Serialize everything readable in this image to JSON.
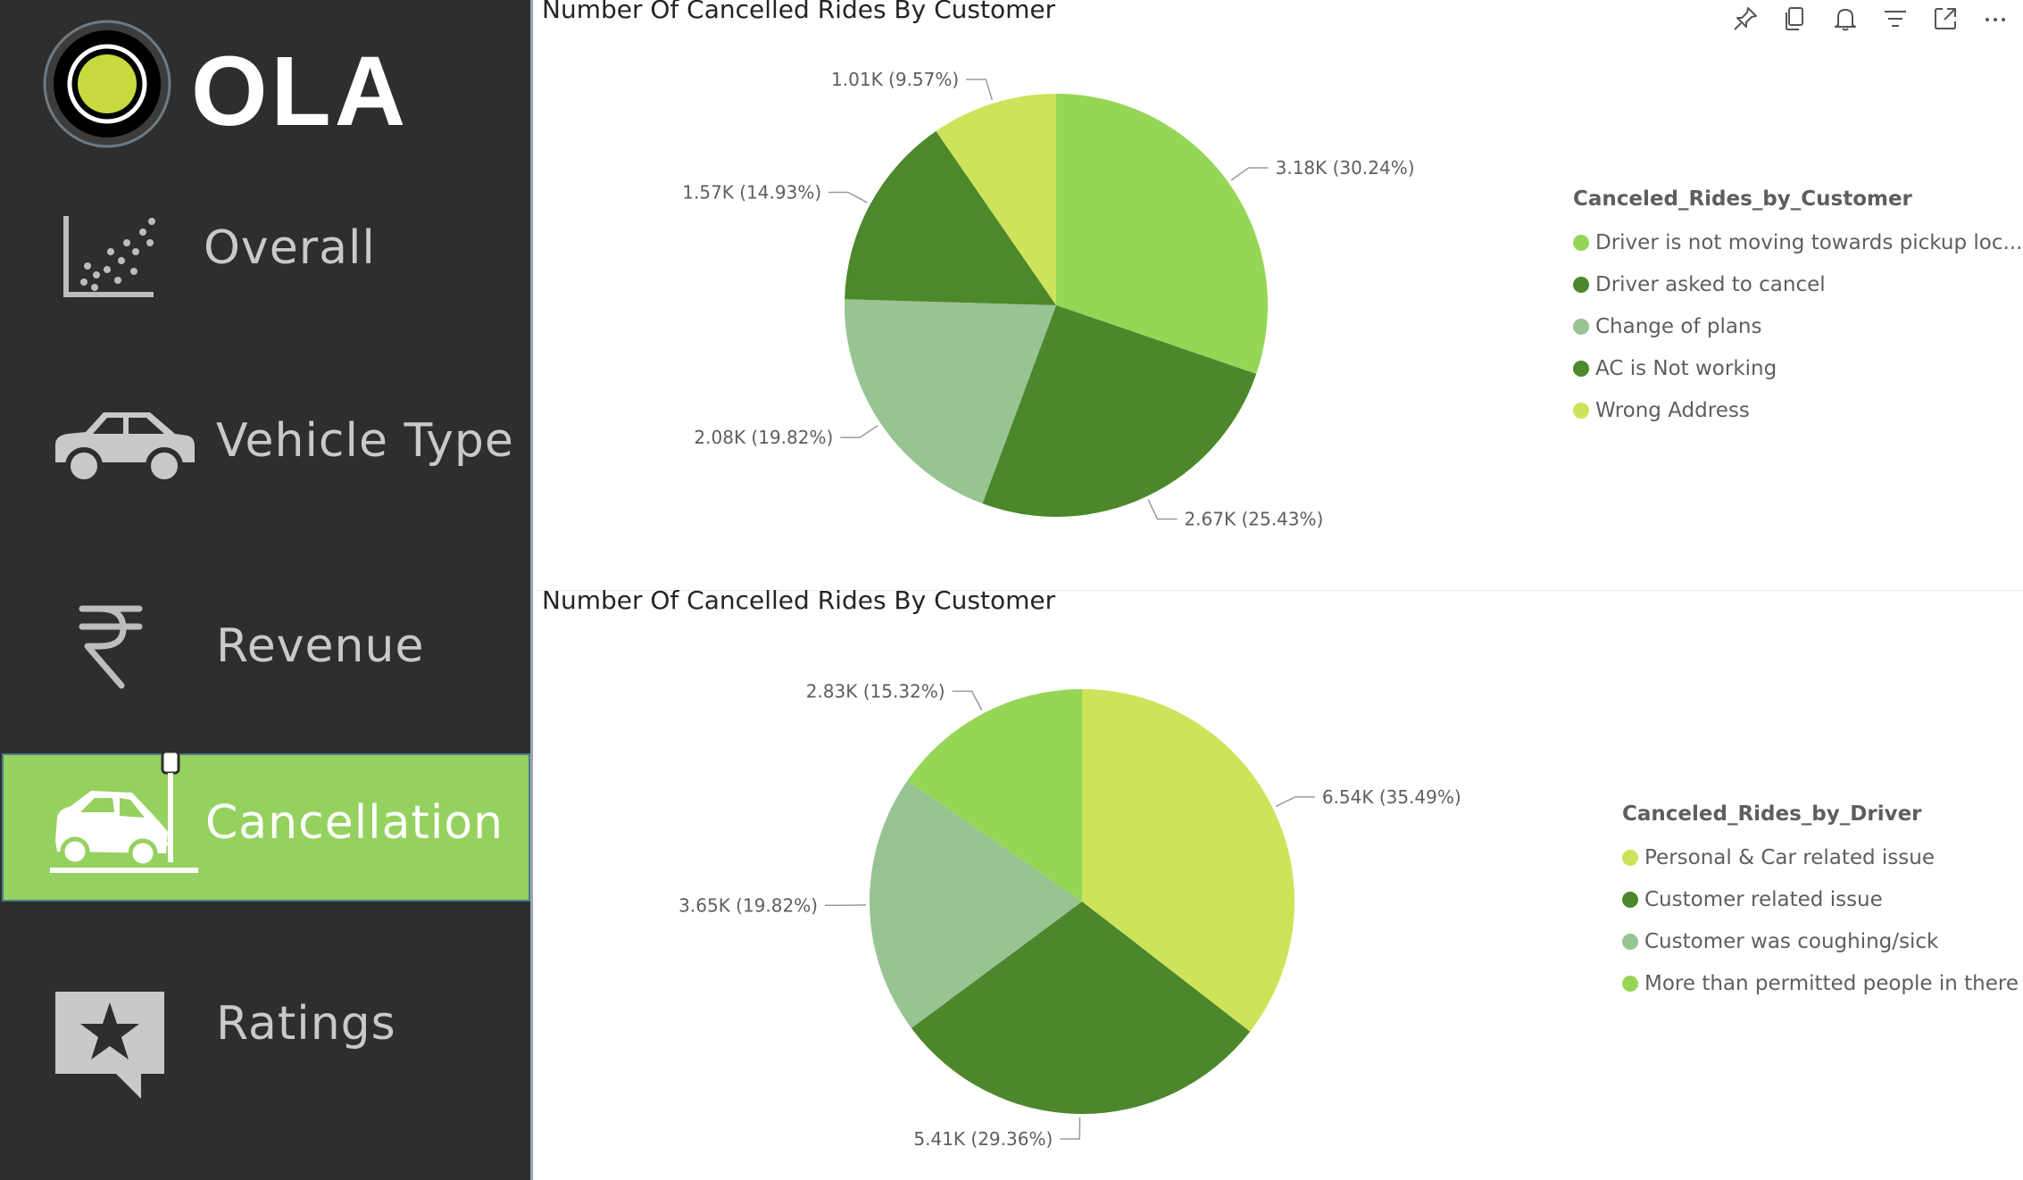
{
  "sidebar": {
    "logo_text": "OLA",
    "items": [
      {
        "label": "Overall",
        "icon": "scatter-plot-icon",
        "active": false
      },
      {
        "label": "Vehicle Type",
        "icon": "car-icon",
        "active": false
      },
      {
        "label": "Revenue",
        "icon": "rupee-icon",
        "active": false
      },
      {
        "label": "Cancellation",
        "icon": "car-crash-icon",
        "active": true
      },
      {
        "label": "Ratings",
        "icon": "star-comment-icon",
        "active": false
      }
    ],
    "active_color": "#95d15e",
    "background": "#2e2e2e"
  },
  "toolbar": {
    "icons": [
      "pin-icon",
      "copy-icon",
      "bell-icon",
      "filter-icon",
      "focus-mode-icon",
      "more-options-icon"
    ]
  },
  "chart_data": [
    {
      "type": "pie",
      "title": "Number Of Cancelled Rides By Customer",
      "legend_title": "Canceled_Rides_by_Customer",
      "legend_position": "right",
      "categories": [
        "Driver is not moving towards pickup loc...",
        "Driver asked to cancel",
        "Change of plans",
        "AC is Not working",
        "Wrong Address"
      ],
      "values": [
        3.18,
        2.67,
        2.08,
        1.57,
        1.01
      ],
      "value_unit": "K",
      "labels": [
        "3.18K (30.24%)",
        "2.67K (25.43%)",
        "2.08K (19.82%)",
        "1.57K (14.93%)",
        "1.01K (9.57%)"
      ],
      "colors": [
        "#96d656",
        "#4c882b",
        "#98c393",
        "#4d882a",
        "#cde45a"
      ]
    },
    {
      "type": "pie",
      "title": "Number Of Cancelled Rides By Customer",
      "legend_title": "Canceled_Rides_by_Driver",
      "legend_position": "right",
      "categories": [
        "Personal & Car related issue",
        "Customer related issue",
        "Customer was coughing/sick",
        "More than permitted people in there"
      ],
      "values": [
        6.54,
        5.41,
        3.65,
        2.83
      ],
      "value_unit": "K",
      "labels": [
        "6.54K (35.49%)",
        "5.41K (29.36%)",
        "3.65K (19.82%)",
        "2.83K (15.32%)"
      ],
      "colors": [
        "#cde45a",
        "#4c882b",
        "#98c393",
        "#96d656"
      ]
    }
  ]
}
